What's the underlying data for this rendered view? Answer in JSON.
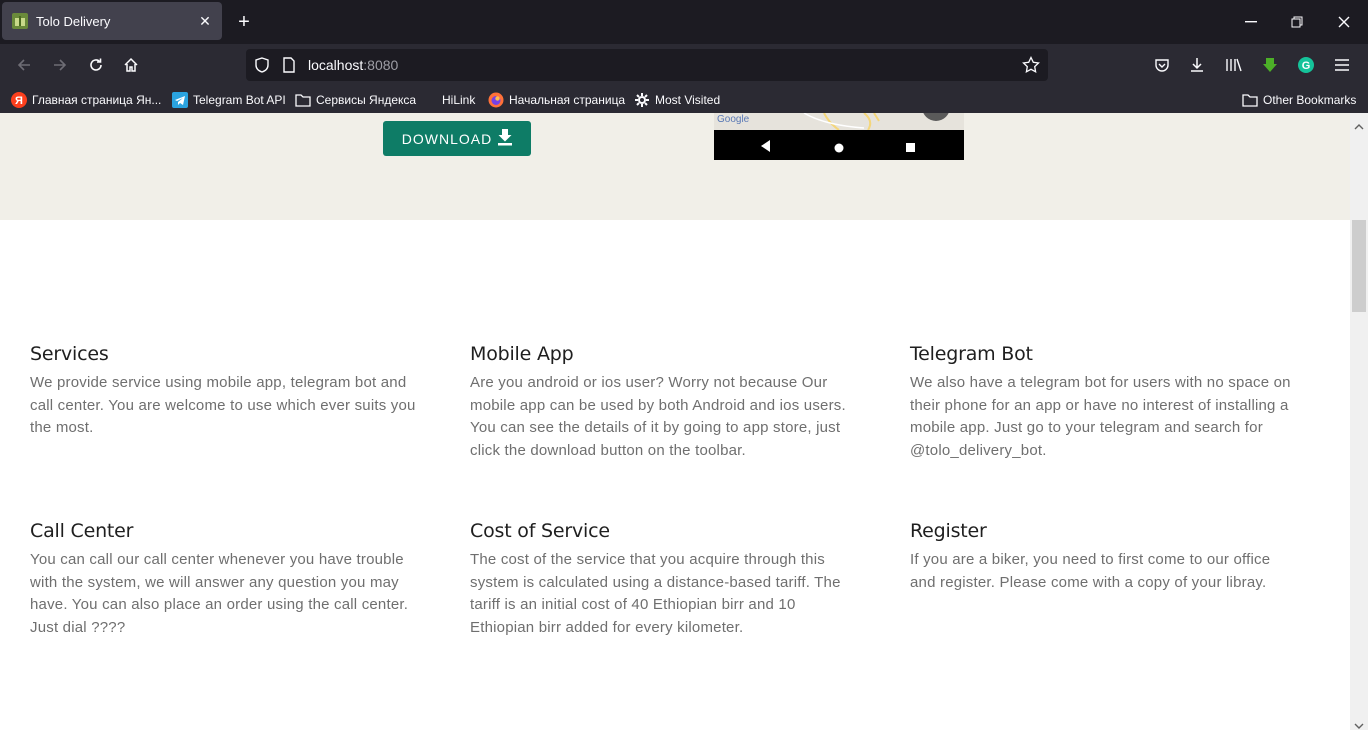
{
  "browser": {
    "tab_title": "Tolo Delivery",
    "url_host": "localhost",
    "url_port": ":8080",
    "bookmarks": [
      "Главная страница Ян...",
      "Telegram Bot API",
      "Сервисы Яндекса",
      "HiLink",
      "Начальная страница",
      "Most Visited"
    ],
    "other_bookmarks": "Other Bookmarks"
  },
  "hero": {
    "download_label": "DOWNLOAD",
    "map_label": "Google"
  },
  "features": [
    {
      "title": "Services",
      "text": "We provide service using mobile app, telegram bot and call center. You are welcome to use which ever suits you the most."
    },
    {
      "title": "Mobile App",
      "text": "Are you android or ios user? Worry not because Our mobile app can be used by both Android and ios users. You can see the details of it by going to app store, just click the download button on the toolbar."
    },
    {
      "title": "Telegram Bot",
      "text": "We also have a telegram bot for users with no space on their phone for an app or have no interest of installing a mobile app. Just go to your telegram and search for @tolo_delivery_bot."
    },
    {
      "title": "Call Center",
      "text": "You can call our call center whenever you have trouble with the system, we will answer any question you may have. You can also place an order using the call center. Just dial ????"
    },
    {
      "title": "Cost of Service",
      "text": "The cost of the service that you acquire through this system is calculated using a distance-based tariff. The tariff is an initial cost of 40 Ethiopian birr and 10 Ethiopian birr added for every kilometer."
    },
    {
      "title": "Register",
      "text": "If you are a biker, you need to first come to our office and register. Please come with a copy of your libray."
    }
  ],
  "colors": {
    "accent": "#0e7c66",
    "hero_bg": "#f1efe8",
    "chrome_dark": "#1c1b22",
    "chrome_toolbar": "#2b2a33"
  }
}
